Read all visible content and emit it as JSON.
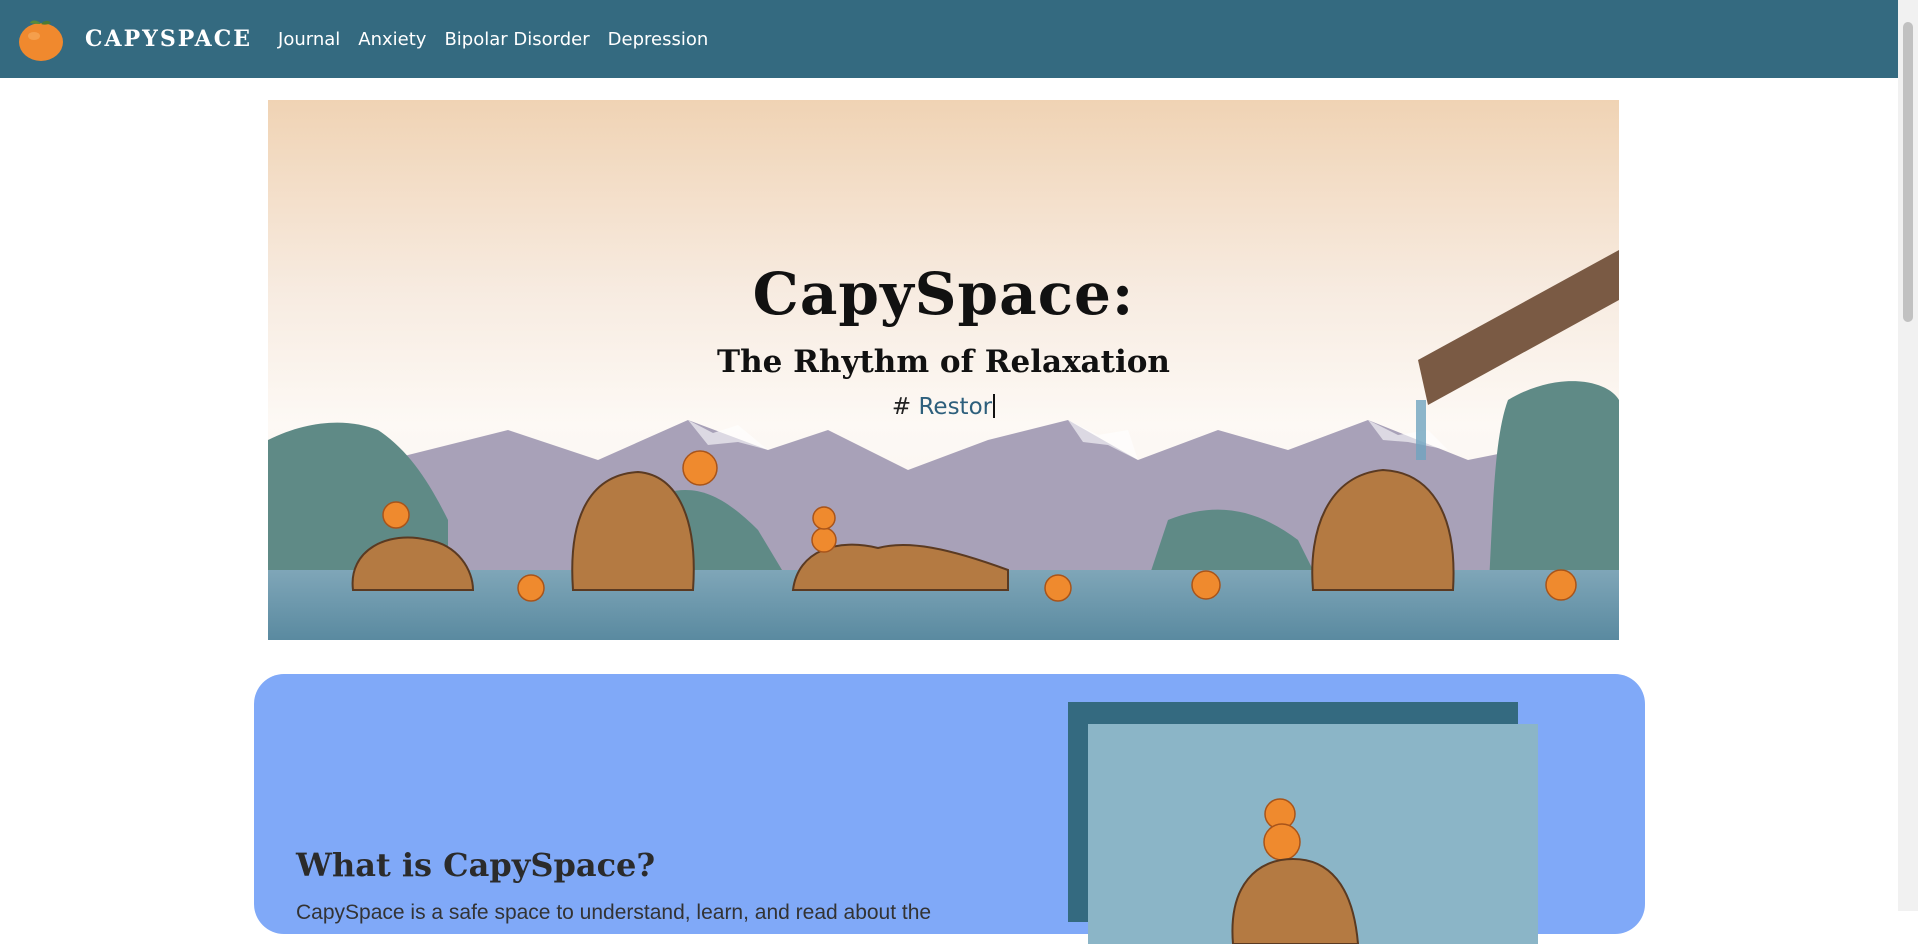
{
  "nav": {
    "logo_icon": "tangerine-icon",
    "brand": "CAPYSPACE",
    "links": [
      "Journal",
      "Anxiety",
      "Bipolar Disorder",
      "Depression"
    ]
  },
  "hero": {
    "title": "CapySpace:",
    "subtitle": "The Rhythm of Relaxation",
    "hash": "#",
    "typed_text": "Restor"
  },
  "about": {
    "title": "What is CapySpace?",
    "text_partial": "CapySpace is a safe space to understand, learn, and read about the"
  },
  "colors": {
    "navbar": "#346a80",
    "about_bg": "#80a9f8",
    "frame_back": "#346a80",
    "frame_front": "#8bb5c7",
    "accent_text": "#2d5f7c"
  }
}
